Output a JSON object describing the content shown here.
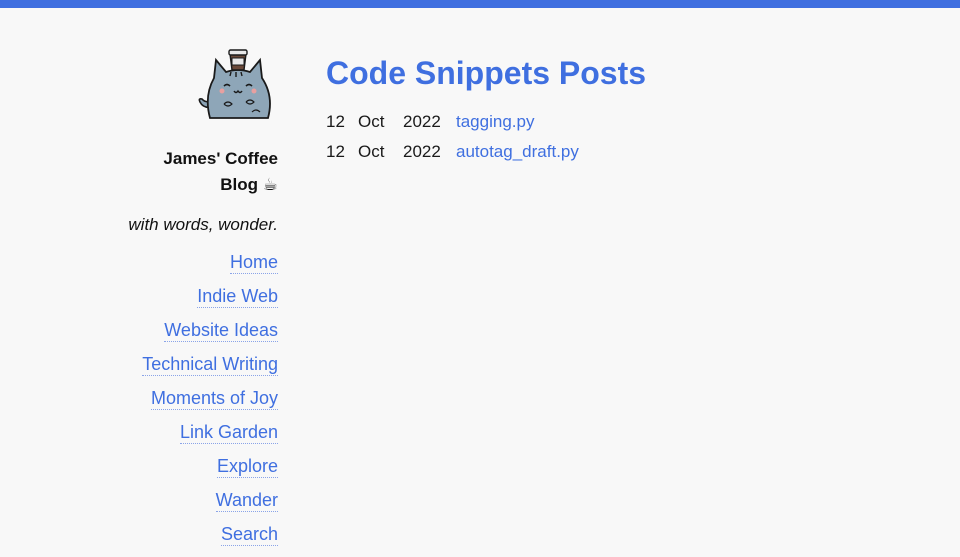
{
  "colors": {
    "accent": "#3f6fe0",
    "background": "#f8f8f8",
    "text": "#111111"
  },
  "site": {
    "logo_icon": "cat-with-coffee-icon",
    "title_line1": "James' Coffee",
    "title_line2": "Blog",
    "title_emoji": "☕",
    "tagline": "with words, wonder."
  },
  "nav": {
    "items": [
      {
        "label": "Home"
      },
      {
        "label": "Indie Web"
      },
      {
        "label": "Website Ideas"
      },
      {
        "label": "Technical Writing"
      },
      {
        "label": "Moments of Joy"
      },
      {
        "label": "Link Garden"
      },
      {
        "label": "Explore"
      },
      {
        "label": "Wander"
      },
      {
        "label": "Search"
      }
    ]
  },
  "main": {
    "title": "Code Snippets Posts",
    "posts": [
      {
        "day": "12",
        "month": "Oct",
        "year": "2022",
        "title": "tagging.py"
      },
      {
        "day": "12",
        "month": "Oct",
        "year": "2022",
        "title": "autotag_draft.py"
      }
    ]
  }
}
